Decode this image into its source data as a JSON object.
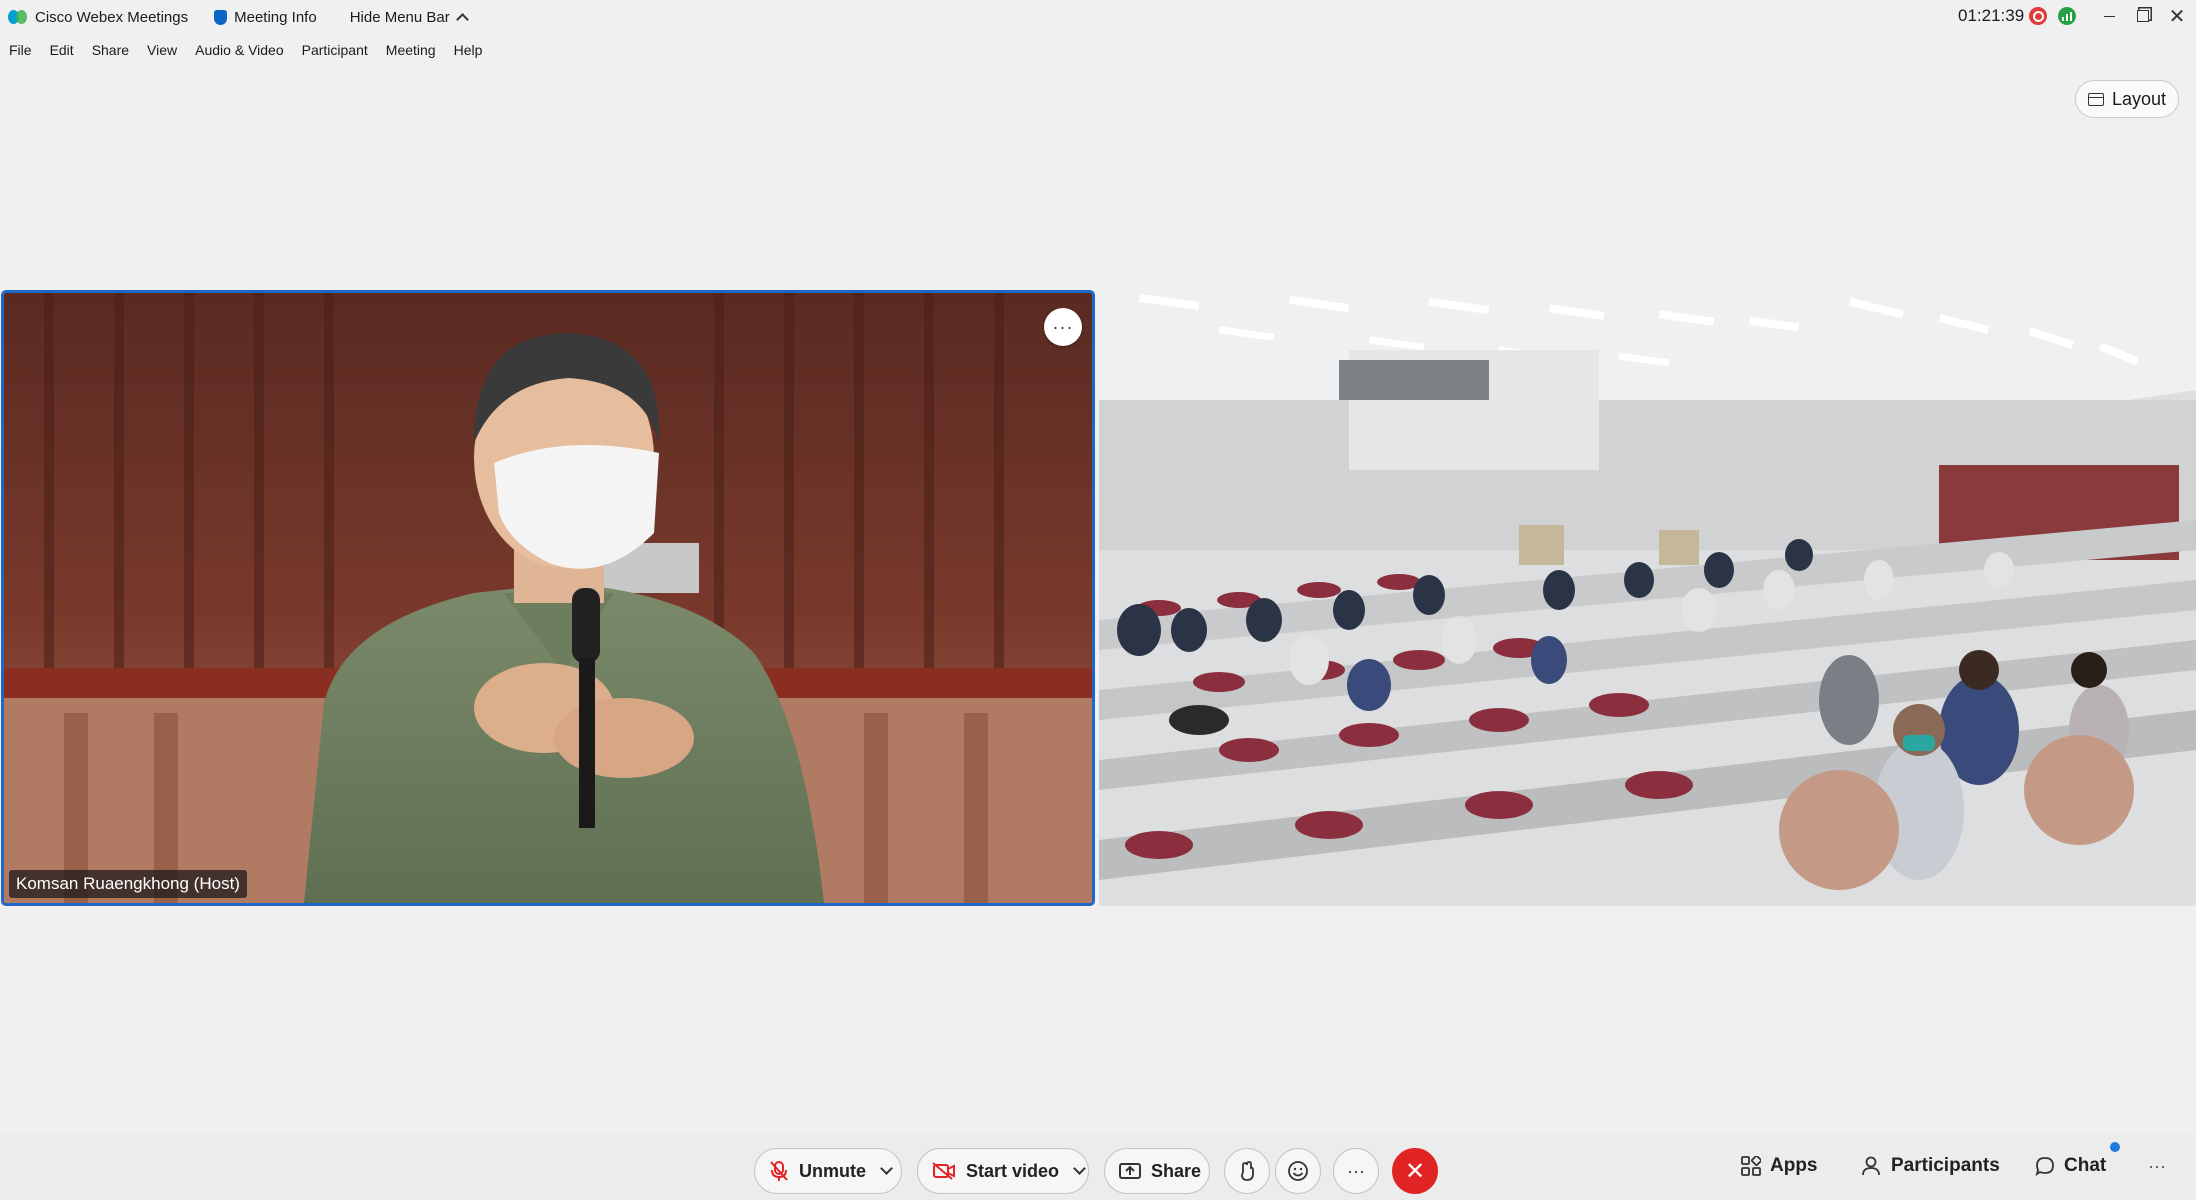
{
  "titlebar": {
    "app_name": "Cisco Webex Meetings",
    "meeting_info": "Meeting Info",
    "hide_menu_bar": "Hide Menu Bar",
    "clock": "01:21:39"
  },
  "menu": [
    "File",
    "Edit",
    "Share",
    "View",
    "Audio & Video",
    "Participant",
    "Meeting",
    "Help"
  ],
  "layout_button": "Layout",
  "video": {
    "host_name": "Komsan Ruaengkhong (Host)",
    "more_label": "···"
  },
  "controls": {
    "unmute": "Unmute",
    "start_video": "Start video",
    "share": "Share",
    "more": "···",
    "apps": "Apps",
    "participants": "Participants",
    "chat": "Chat",
    "overflow": "···"
  },
  "icons": {
    "mic_off": "mic-off-icon",
    "camera_off": "camera-off-icon",
    "share": "share-icon",
    "raise_hand": "raise-hand-icon",
    "reactions": "reactions-icon",
    "end_call": "end-call-icon"
  },
  "colors": {
    "active_speaker_border": "#1f66c9",
    "end_call": "#e02424",
    "recording": "#e23b3b",
    "network": "#25a244"
  }
}
